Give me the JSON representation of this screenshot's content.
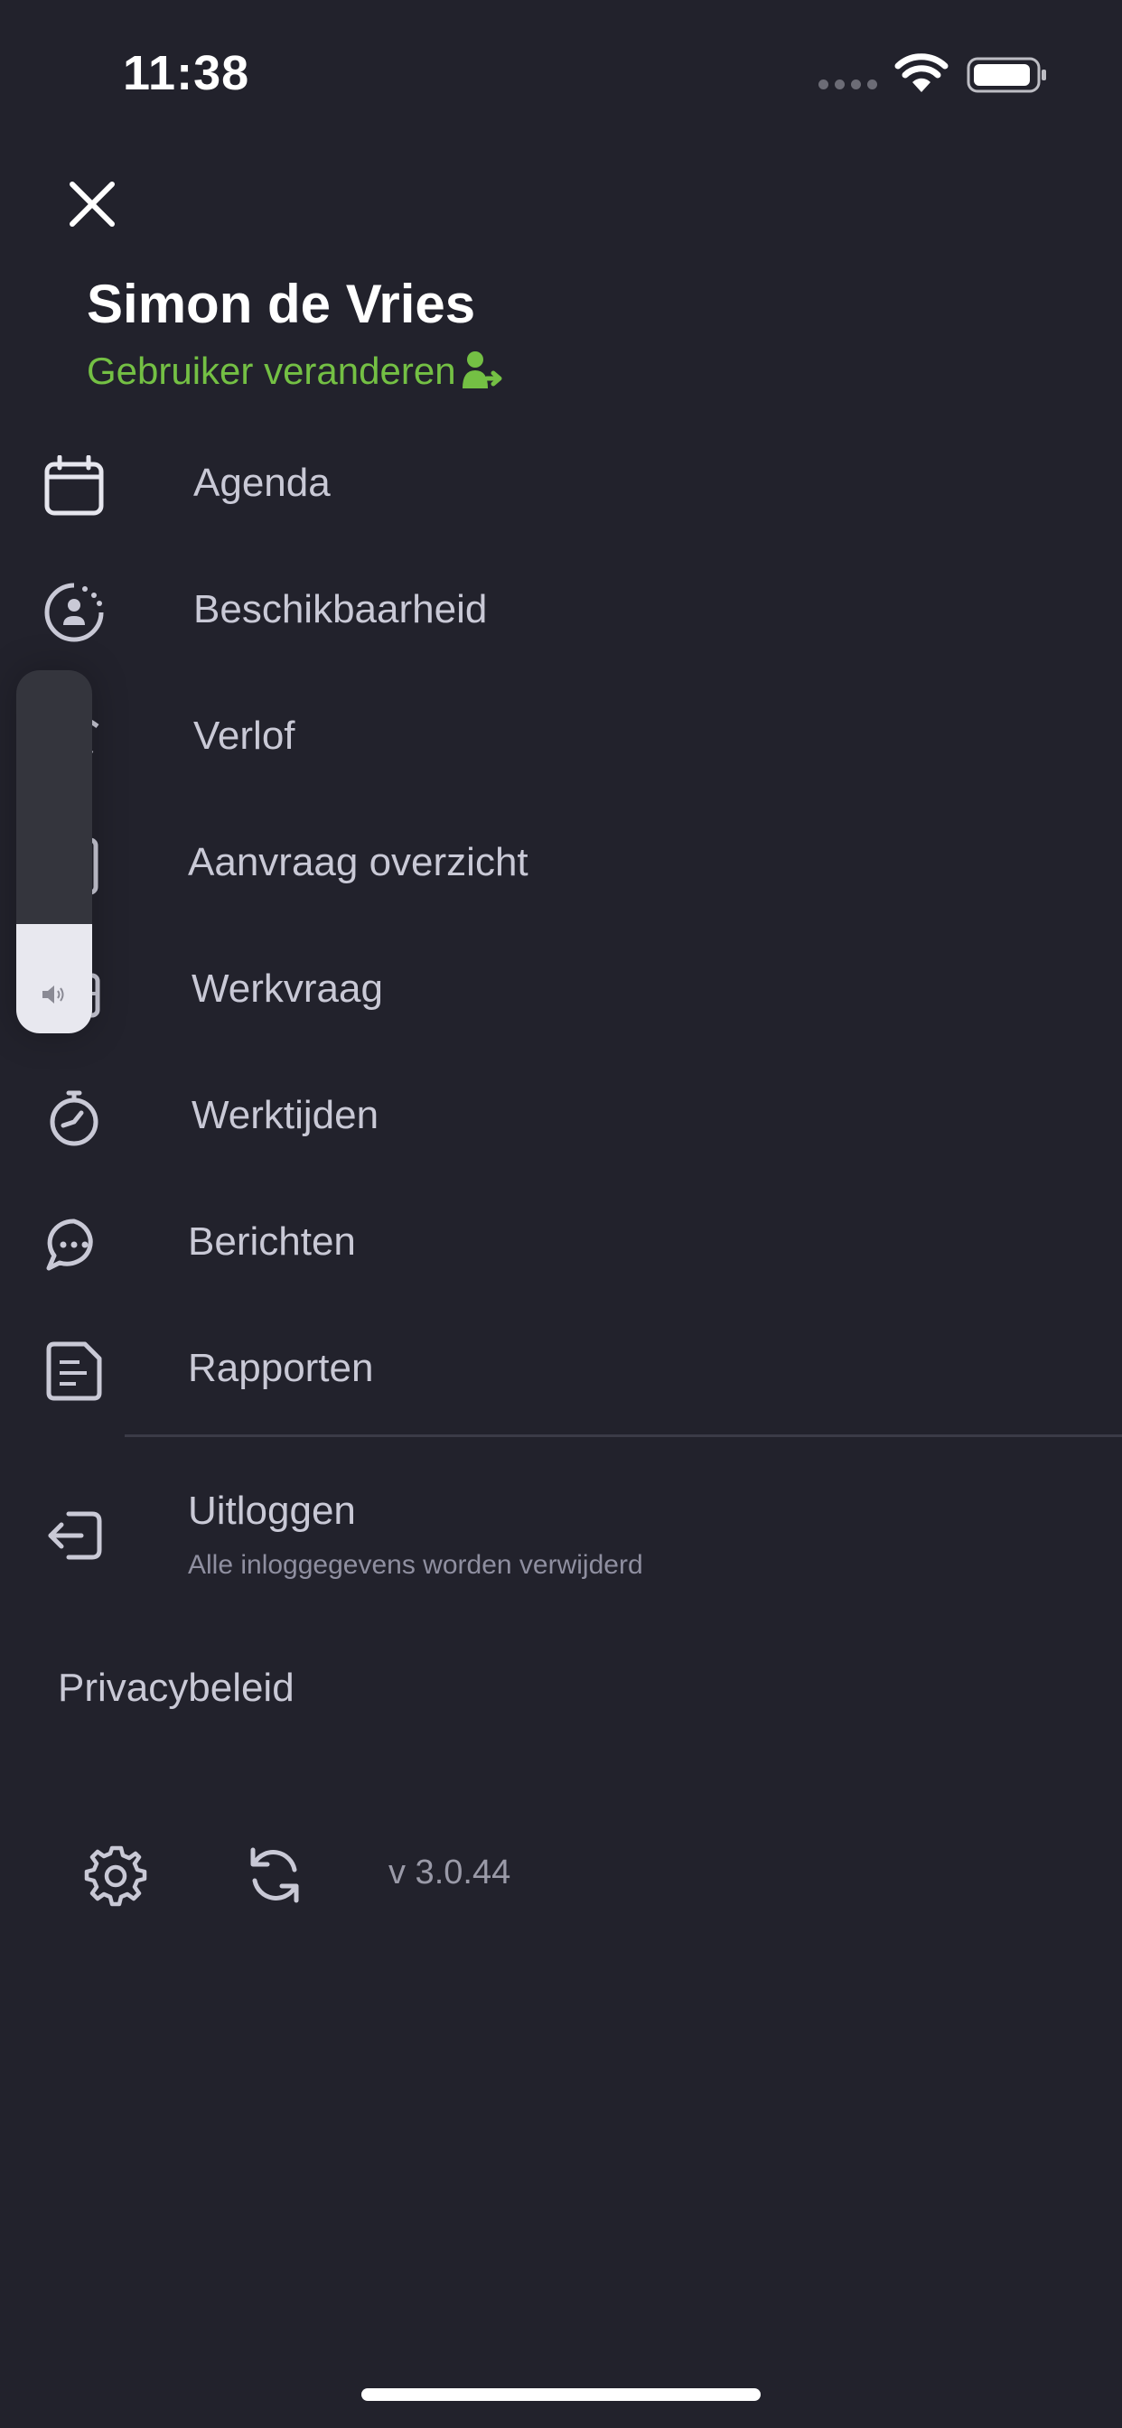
{
  "status_bar": {
    "time": "11:38"
  },
  "user": {
    "name": "Simon de Vries",
    "switch_label": "Gebruiker veranderen"
  },
  "menu": [
    {
      "label": "Agenda",
      "icon": "calendar-icon"
    },
    {
      "label": "Beschikbaarheid",
      "icon": "availability-icon"
    },
    {
      "label": "Verlof",
      "icon": "leave-icon"
    },
    {
      "label": "Aanvraag overzicht",
      "icon": "request-overview-icon"
    },
    {
      "label": "Werkvraag",
      "icon": "work-demand-icon"
    },
    {
      "label": "Werktijden",
      "icon": "stopwatch-icon"
    },
    {
      "label": "Berichten",
      "icon": "chat-bubble-icon"
    },
    {
      "label": "Rapporten",
      "icon": "report-icon"
    }
  ],
  "logout": {
    "label": "Uitloggen",
    "sublabel": "Alle inloggegevens worden verwijderd"
  },
  "privacy_label": "Privacybeleid",
  "footer": {
    "version": "v 3.0.44"
  },
  "volume_hud": {
    "level": 0.3
  },
  "colors": {
    "background": "#22222c",
    "accent_green": "#74c044",
    "text": "#c9c9d6"
  }
}
